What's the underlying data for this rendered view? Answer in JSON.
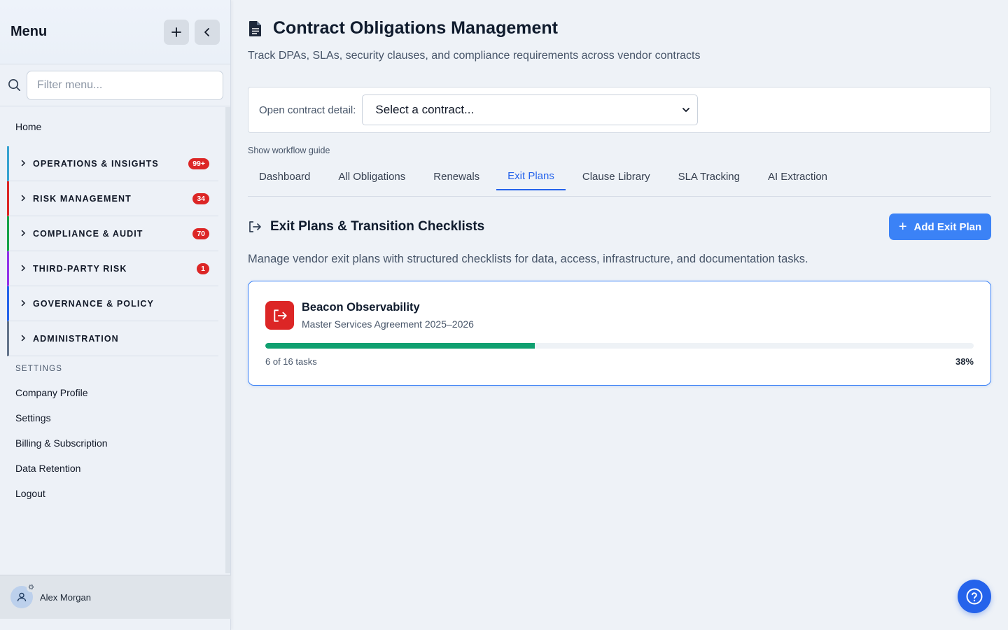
{
  "sidebar": {
    "title": "Menu",
    "add_icon": "plus-icon",
    "collapse_icon": "chevron-left-icon",
    "search": {
      "placeholder": "Filter menu...",
      "value": ""
    },
    "home_label": "Home",
    "groups": [
      {
        "label": "OPERATIONS & INSIGHTS",
        "badge": "99+",
        "color": "#38a3d1"
      },
      {
        "label": "RISK MANAGEMENT",
        "badge": "34",
        "color": "#dc2626"
      },
      {
        "label": "COMPLIANCE & AUDIT",
        "badge": "70",
        "color": "#16a34a"
      },
      {
        "label": "THIRD-PARTY RISK",
        "badge": "1",
        "color": "#9333ea"
      },
      {
        "label": "GOVERNANCE & POLICY",
        "badge": "",
        "color": "#2563eb"
      },
      {
        "label": "ADMINISTRATION",
        "badge": "",
        "color": "#64748b"
      }
    ],
    "settings_heading": "SETTINGS",
    "settings_links": [
      "Company Profile",
      "Settings",
      "Billing & Subscription",
      "Data Retention",
      "Logout"
    ],
    "user": {
      "name": "Alex Morgan"
    }
  },
  "header": {
    "title": "Contract Obligations Management",
    "subtitle": "Track DPAs, SLAs, security clauses, and compliance requirements across vendor contracts"
  },
  "contract_picker": {
    "label": "Open contract detail:",
    "selected": "Select a contract..."
  },
  "workflow_guide": "Show workflow guide",
  "tabs": [
    {
      "label": "Dashboard",
      "active": false
    },
    {
      "label": "All Obligations",
      "active": false
    },
    {
      "label": "Renewals",
      "active": false
    },
    {
      "label": "Exit Plans",
      "active": true
    },
    {
      "label": "Clause Library",
      "active": false
    },
    {
      "label": "SLA Tracking",
      "active": false
    },
    {
      "label": "AI Extraction",
      "active": false
    }
  ],
  "section": {
    "title": "Exit Plans & Transition Checklists",
    "add_button": "Add Exit Plan",
    "description": "Manage vendor exit plans with structured checklists for data, access, infrastructure, and documentation tasks."
  },
  "exit_plans": [
    {
      "vendor": "Beacon Observability",
      "contract": "Master Services Agreement 2025–2026",
      "tasks_text": "6 of 16 tasks",
      "percent_text": "38%",
      "progress": 0.38
    }
  ],
  "colors": {
    "accent": "#3b82f6",
    "danger": "#dc2626",
    "success": "#10a070"
  }
}
